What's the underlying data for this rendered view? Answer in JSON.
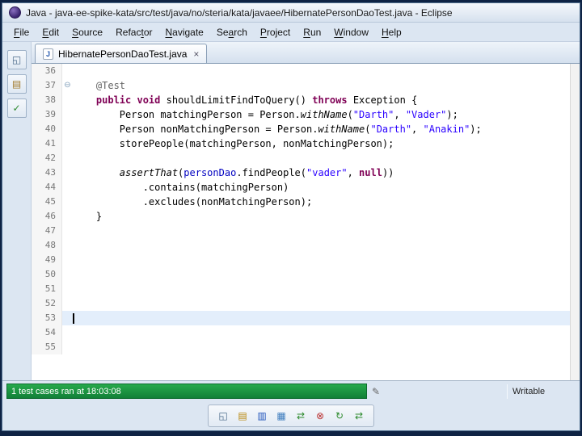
{
  "window": {
    "title": "Java - java-ee-spike-kata/src/test/java/no/steria/kata/javaee/HibernatePersonDaoTest.java - Eclipse"
  },
  "menu": {
    "items": [
      {
        "label": "File",
        "m": 0
      },
      {
        "label": "Edit",
        "m": 0
      },
      {
        "label": "Source",
        "m": 0
      },
      {
        "label": "Refactor",
        "m": 5
      },
      {
        "label": "Navigate",
        "m": 0
      },
      {
        "label": "Search",
        "m": 2
      },
      {
        "label": "Project",
        "m": 0
      },
      {
        "label": "Run",
        "m": 0
      },
      {
        "label": "Window",
        "m": 0
      },
      {
        "label": "Help",
        "m": 0
      }
    ]
  },
  "left_rail": {
    "icons": [
      {
        "name": "restore-view-icon",
        "glyph": "◱",
        "color": "#4a6a8a"
      },
      {
        "name": "package-explorer-icon",
        "glyph": "▤",
        "color": "#a07828"
      },
      {
        "name": "junit-view-icon",
        "glyph": "✓",
        "color": "#2e8b2e"
      }
    ]
  },
  "tab": {
    "label": "HibernatePersonDaoTest.java",
    "file_icon_letter": "J",
    "close_glyph": "×"
  },
  "editor": {
    "lines": [
      {
        "num": 36
      },
      {
        "num": 37,
        "fold": true,
        "segments": [
          {
            "c": "pl",
            "t": "    "
          },
          {
            "c": "ann",
            "t": "@Test"
          }
        ]
      },
      {
        "num": 38,
        "segments": [
          {
            "c": "pl",
            "t": "    "
          },
          {
            "c": "kw",
            "t": "public void"
          },
          {
            "c": "pl",
            "t": " shouldLimitFindToQuery() "
          },
          {
            "c": "kw",
            "t": "throws"
          },
          {
            "c": "pl",
            "t": " Exception {"
          }
        ]
      },
      {
        "num": 39,
        "segments": [
          {
            "c": "pl",
            "t": "        Person matchingPerson = Person."
          },
          {
            "c": "it",
            "t": "withName"
          },
          {
            "c": "pl",
            "t": "("
          },
          {
            "c": "str",
            "t": "\"Darth\""
          },
          {
            "c": "pl",
            "t": ", "
          },
          {
            "c": "str",
            "t": "\"Vader\""
          },
          {
            "c": "pl",
            "t": ");"
          }
        ]
      },
      {
        "num": 40,
        "segments": [
          {
            "c": "pl",
            "t": "        Person nonMatchingPerson = Person."
          },
          {
            "c": "it",
            "t": "withName"
          },
          {
            "c": "pl",
            "t": "("
          },
          {
            "c": "str",
            "t": "\"Darth\""
          },
          {
            "c": "pl",
            "t": ", "
          },
          {
            "c": "str",
            "t": "\"Anakin\""
          },
          {
            "c": "pl",
            "t": ");"
          }
        ]
      },
      {
        "num": 41,
        "segments": [
          {
            "c": "pl",
            "t": "        storePeople(matchingPerson, nonMatchingPerson);"
          }
        ]
      },
      {
        "num": 42
      },
      {
        "num": 43,
        "segments": [
          {
            "c": "pl",
            "t": "        "
          },
          {
            "c": "it",
            "t": "assertThat"
          },
          {
            "c": "pl",
            "t": "("
          },
          {
            "c": "fld",
            "t": "personDao"
          },
          {
            "c": "pl",
            "t": ".findPeople("
          },
          {
            "c": "str",
            "t": "\"vader\""
          },
          {
            "c": "pl",
            "t": ", "
          },
          {
            "c": "kw",
            "t": "null"
          },
          {
            "c": "pl",
            "t": "))"
          }
        ]
      },
      {
        "num": 44,
        "segments": [
          {
            "c": "pl",
            "t": "            .contains(matchingPerson)"
          }
        ]
      },
      {
        "num": 45,
        "segments": [
          {
            "c": "pl",
            "t": "            .excludes(nonMatchingPerson);"
          }
        ]
      },
      {
        "num": 46,
        "segments": [
          {
            "c": "pl",
            "t": "    }"
          }
        ]
      },
      {
        "num": 47
      },
      {
        "num": 48
      },
      {
        "num": 49
      },
      {
        "num": 50
      },
      {
        "num": 51
      },
      {
        "num": 52
      },
      {
        "num": 53,
        "current": true,
        "caret": true
      },
      {
        "num": 54
      },
      {
        "num": 55
      }
    ],
    "fold_glyph": "⊖"
  },
  "status": {
    "progress_text": "1 test cases ran at 18:03:08",
    "writable_label": "Writable",
    "pencil_glyph": "✎"
  },
  "bottom_toolbar": {
    "icons": [
      {
        "name": "restore-junit-view-icon",
        "glyph": "◱",
        "color": "#4a6a8a"
      },
      {
        "name": "test-hierarchy-icon",
        "glyph": "▤",
        "color": "#b8860b"
      },
      {
        "name": "test-report-icon",
        "glyph": "▥",
        "color": "#2255bb"
      },
      {
        "name": "console-icon",
        "glyph": "▦",
        "color": "#3a7abd"
      },
      {
        "name": "rerun-tests-icon",
        "glyph": "⇄",
        "color": "#2e8b2e"
      },
      {
        "name": "stop-test-icon",
        "glyph": "⊗",
        "color": "#bb3333"
      },
      {
        "name": "rerun-failed-test-icon",
        "glyph": "↻",
        "color": "#2e8b2e"
      },
      {
        "name": "relaunch-icon",
        "glyph": "⇄",
        "color": "#2e8b2e"
      }
    ]
  }
}
